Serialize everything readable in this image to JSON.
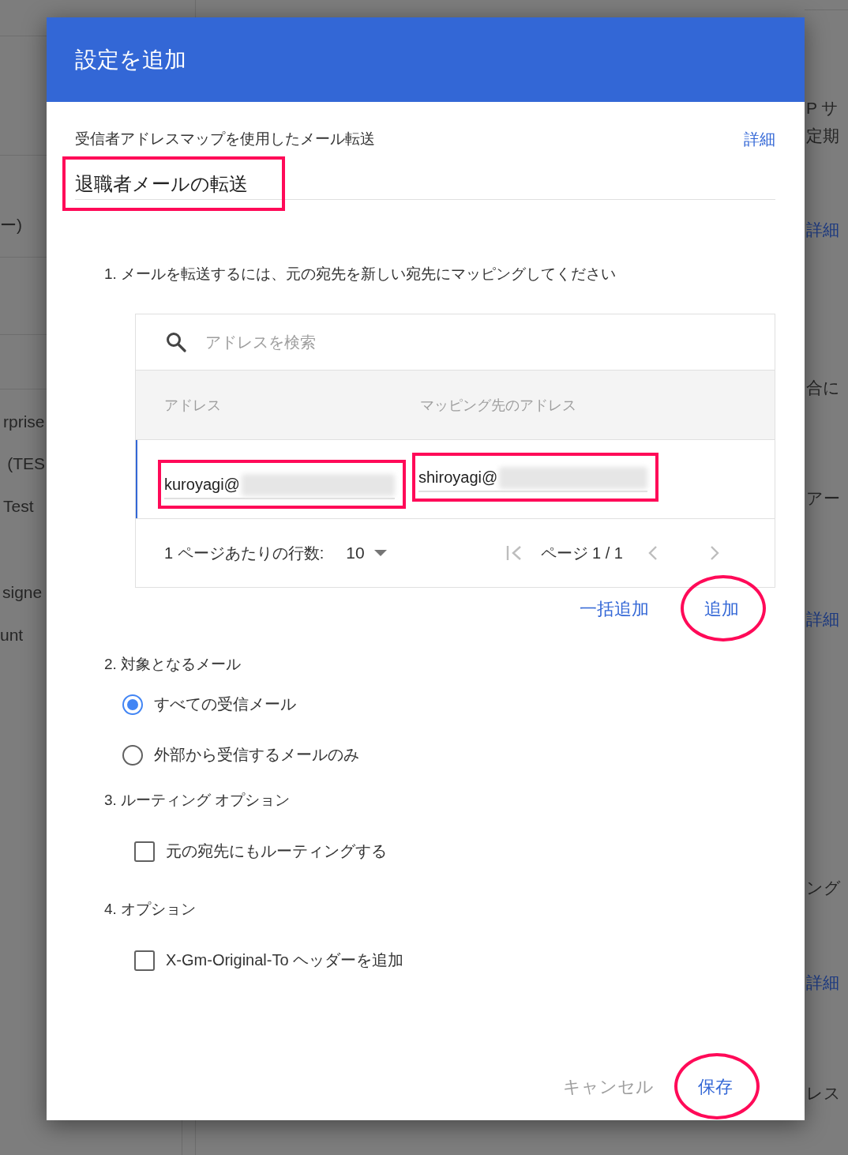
{
  "background": {
    "left_fragments": [
      "ー)",
      "rprise",
      "(TES",
      "Test",
      "signe",
      "unt"
    ],
    "right_fragments": [
      {
        "text": "P サ",
        "kind": "text"
      },
      {
        "text": "定期",
        "kind": "text"
      },
      {
        "text": "詳細",
        "kind": "link"
      },
      {
        "text": "合に",
        "kind": "text"
      },
      {
        "text": "アー",
        "kind": "text"
      },
      {
        "text": "詳細",
        "kind": "link"
      },
      {
        "text": "ング",
        "kind": "text"
      },
      {
        "text": "詳細",
        "kind": "link"
      },
      {
        "text": "レス",
        "kind": "text"
      }
    ]
  },
  "dialog": {
    "title": "設定を追加",
    "setting_type": "受信者アドレスマップを使用したメール転送",
    "help_link": "詳細",
    "name_field": {
      "value": "退職者メールの転送",
      "highlighted": true
    },
    "step_1": {
      "label": "1. メールを転送するには、元の宛先を新しい宛先にマッピングしてください",
      "search": {
        "placeholder": "アドレスを検索"
      },
      "table": {
        "columns": [
          "アドレス",
          "マッピング先のアドレス"
        ],
        "rows": [
          {
            "address": "kuroyagi@",
            "mapped_address": "shiroyagi@",
            "highlighted": true
          }
        ]
      },
      "pagination": {
        "rows_per_page_label": "1 ページあたりの行数:",
        "rows_per_page": "10",
        "page": "ページ 1 / 1"
      },
      "actions": [
        {
          "label": "一括追加",
          "highlighted": false
        },
        {
          "label": "追加",
          "highlighted": true
        }
      ]
    },
    "step_2": {
      "label": "2. 対象となるメール",
      "options": [
        {
          "label": "すべての受信メール",
          "selected": true
        },
        {
          "label": "外部から受信するメールのみ",
          "selected": false
        }
      ]
    },
    "step_3": {
      "label": "3. ルーティング オプション",
      "options": [
        {
          "label": "元の宛先にもルーティングする",
          "checked": false
        }
      ]
    },
    "step_4": {
      "label": "4. オプション",
      "options": [
        {
          "label": "X-Gm-Original-To ヘッダーを追加",
          "checked": false
        }
      ]
    },
    "buttons": [
      {
        "label": "キャンセル",
        "kind": "secondary",
        "highlighted": false
      },
      {
        "label": "保存",
        "kind": "primary",
        "highlighted": true
      }
    ]
  }
}
